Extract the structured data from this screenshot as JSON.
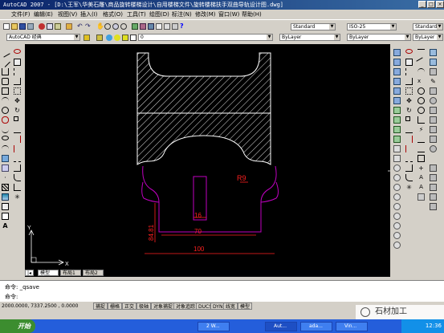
{
  "window": {
    "title": "AutoCAD 2007 - [D:\\王军\\华美石雕\\商品旋转楼梯设计\\自用楼梯文件\\旋转楼梯扶手双曲导轨设计图.dwg]"
  },
  "menu": [
    "文件(F)",
    "编辑(E)",
    "视图(V)",
    "插入(I)",
    "格式(O)",
    "工具(T)",
    "绘图(D)",
    "标注(N)",
    "修改(M)",
    "窗口(W)",
    "帮助(H)"
  ],
  "toolbar": {
    "workspace": "AutoCAD 经典",
    "layer": "0",
    "text_style": "Standard",
    "dim_style": "ISO-25",
    "table_style": "Standard",
    "color": "ByLayer",
    "linetype": "ByLayer",
    "lineweight": "ByLayer"
  },
  "drawing": {
    "dims": {
      "radius": "R9",
      "height": "84.81",
      "inner": "16",
      "middle": "70",
      "outer": "100"
    },
    "ucs": {
      "x": "X",
      "y": "Y"
    }
  },
  "layout_tabs": [
    "模型",
    "布局1",
    "布局2"
  ],
  "command": {
    "line1": "命令: _qsave",
    "line2": "命令:"
  },
  "status": {
    "coords": "2000.0000, 7337.2500 , 0.0000",
    "buttons": [
      "捕捉",
      "栅格",
      "正交",
      "极轴",
      "对象捕捉",
      "对象追踪",
      "DUCS",
      "DYN",
      "线宽",
      "模型"
    ]
  },
  "taskbar": {
    "start": "开始",
    "tasks": [
      "2 W...",
      "Aut...",
      "ada...",
      "Vin..."
    ],
    "clock": "12:36"
  },
  "watermark": "石材加工",
  "colors": {
    "canvas": "#000000",
    "hatch": "#ffffff",
    "magenta": "#c000c0",
    "dim": "#ff2020",
    "taskbar": "#245edb"
  }
}
